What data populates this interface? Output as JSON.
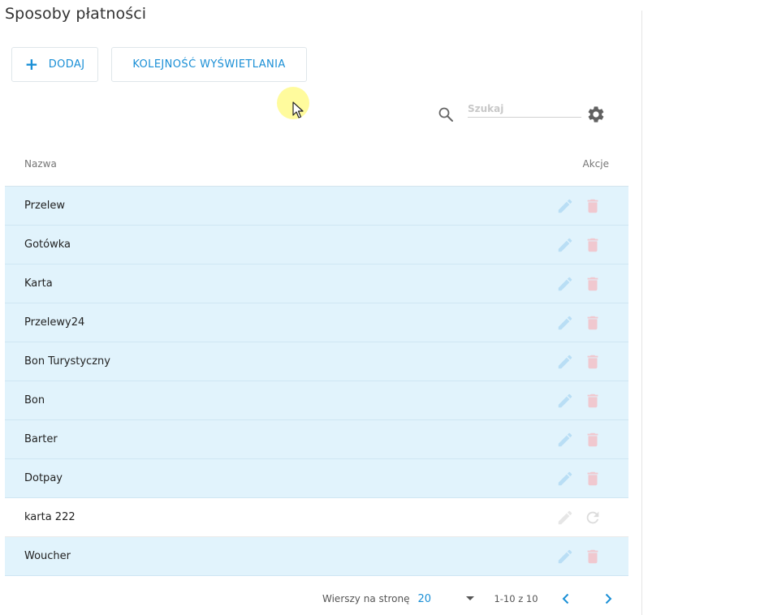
{
  "page": {
    "title": "Sposoby płatności"
  },
  "toolbar": {
    "add_label": "DODAJ",
    "order_label": "KOLEJNOŚĆ WYŚWIETLANIA"
  },
  "search": {
    "placeholder": "Szukaj",
    "value": ""
  },
  "table": {
    "columns": {
      "name": "Nazwa",
      "actions": "Akcje"
    },
    "rows": [
      {
        "name": "Przelew",
        "active": true
      },
      {
        "name": "Gotówka",
        "active": true
      },
      {
        "name": "Karta",
        "active": true
      },
      {
        "name": "Przelewy24",
        "active": true
      },
      {
        "name": "Bon Turystyczny",
        "active": true
      },
      {
        "name": "Bon",
        "active": true
      },
      {
        "name": "Barter",
        "active": true
      },
      {
        "name": "Dotpay",
        "active": true
      },
      {
        "name": "karta 222",
        "active": false
      },
      {
        "name": "Woucher",
        "active": true
      }
    ]
  },
  "pagination": {
    "rows_per_page_label": "Wierszy na stronę",
    "rows_per_page_value": "20",
    "range_text": "1-10 z 10"
  },
  "colors": {
    "accent": "#1a8fd6",
    "active_row_bg": "#e1f3fc",
    "edit_icon": "#b9def5",
    "delete_icon": "#f0c8cf",
    "disabled_icon": "#dcdcdc",
    "gear_icon": "#616161"
  },
  "icons": {
    "add": "plus-icon",
    "search": "search-icon",
    "settings": "gear-icon",
    "edit": "pencil-icon",
    "delete": "trash-icon",
    "restore": "refresh-icon",
    "prev": "chevron-left-icon",
    "next": "chevron-right-icon",
    "select": "caret-down-icon"
  }
}
